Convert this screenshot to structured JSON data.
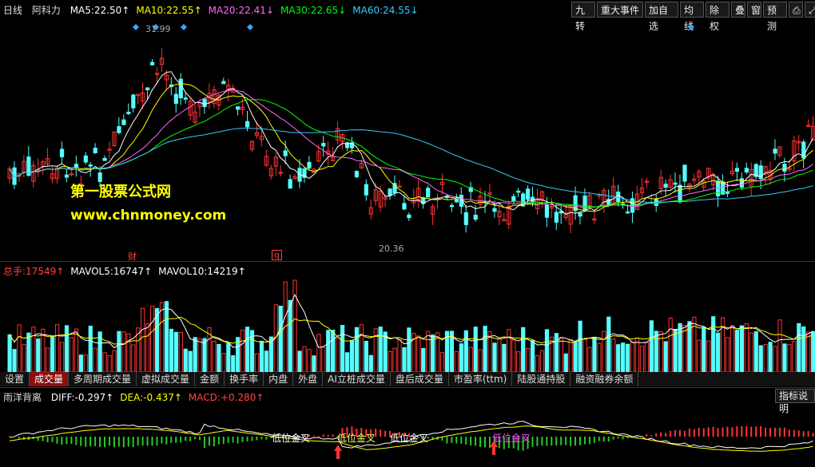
{
  "top_bar": {
    "period": "日线",
    "stock_name": "阿科力",
    "ma": [
      {
        "label": "MA5:",
        "value": "22.50",
        "arrow": "↑",
        "color": "#ffffff"
      },
      {
        "label": "MA10:",
        "value": "22.55",
        "arrow": "↑",
        "color": "#ffff00"
      },
      {
        "label": "MA20:",
        "value": "22.41",
        "arrow": "↓",
        "color": "#ff66ff"
      },
      {
        "label": "MA30:",
        "value": "22.65",
        "arrow": "↓",
        "color": "#00ff00"
      },
      {
        "label": "MA60:",
        "value": "24.55",
        "arrow": "↓",
        "color": "#33ccff"
      }
    ],
    "buttons": [
      "九转",
      "重大事件",
      "加自选",
      "均线",
      "除权",
      "叠",
      "窗",
      "预测",
      "⎙",
      "⤢"
    ]
  },
  "price_chart": {
    "high_label": "31.99",
    "low_label": "20.36",
    "event_markers": [
      "财",
      "q"
    ],
    "watermark_cn": "第一股票公式网",
    "watermark_url": "www.chnmoney.com",
    "up_color": "#ff3333",
    "down_color": "#54ffff"
  },
  "volume_bar": {
    "items": [
      {
        "label": "总手:",
        "value": "17549",
        "arrow": "↑",
        "color": "#ff4444"
      },
      {
        "label": "MAVOL5:",
        "value": "16747",
        "arrow": "↑",
        "color": "#ffffff"
      },
      {
        "label": "MAVOL10:",
        "value": "14219",
        "arrow": "↑",
        "color": "#ffffff"
      }
    ]
  },
  "tabs": [
    "设置",
    "成交量",
    "多周期成交量",
    "虚拟成交量",
    "金额",
    "换手率",
    "内盘",
    "外盘",
    "AI立桩成交量",
    "盘后成交量",
    "市盈率(ttm)",
    "陆股通持股",
    "融资融券余额"
  ],
  "active_tab": "成交量",
  "macd_bar": {
    "title": "雨洋背离",
    "items": [
      {
        "label": "DIFF:",
        "value": "-0.297",
        "arrow": "↑",
        "color": "#ffffff"
      },
      {
        "label": "DEA:",
        "value": "-0.437",
        "arrow": "↑",
        "color": "#ffff00"
      },
      {
        "label": "MACD:",
        "value": "+0.280",
        "arrow": "↑",
        "color": "#ff4444"
      }
    ],
    "help_button": "指标说明",
    "signals": [
      "低位金叉",
      "低位金叉",
      "低位金叉",
      "低位金叉"
    ]
  }
}
